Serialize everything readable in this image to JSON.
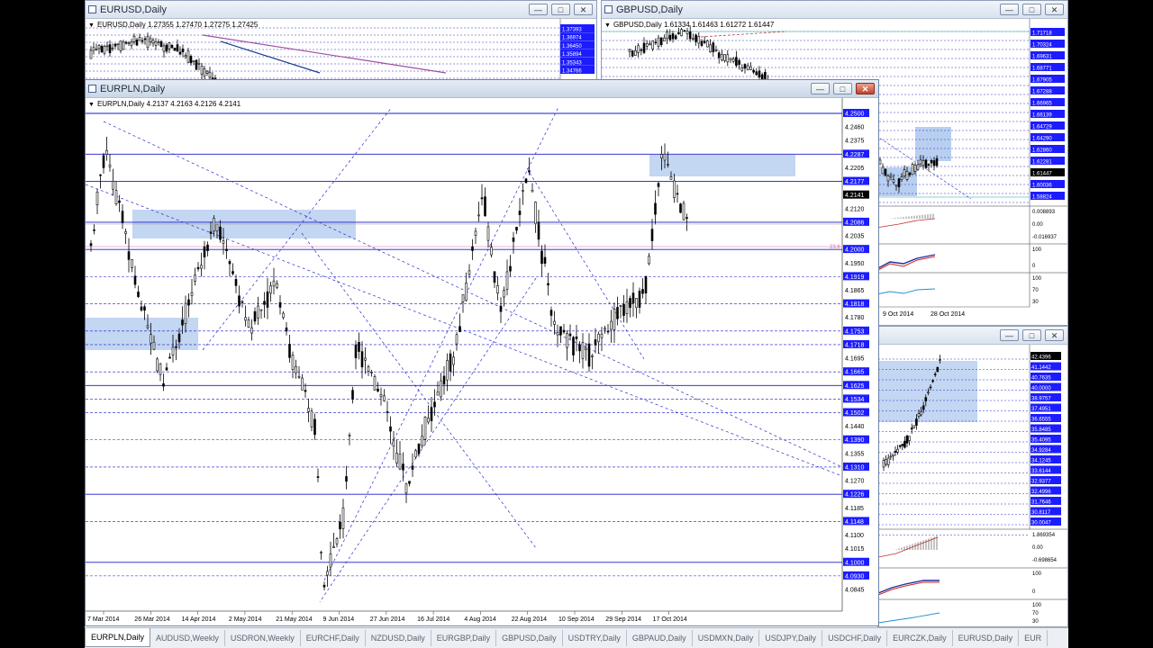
{
  "windows": {
    "eurusd": {
      "title": "EURUSD,Daily",
      "ohlc": "EURUSD,Daily  1.27355 1.27470 1.27275 1.27425",
      "price_labels": [
        "1.37393",
        "1.36974",
        "1.36450",
        "1.35894",
        "1.35343",
        "1.34766"
      ]
    },
    "gbpusd": {
      "title": "GBPUSD,Daily",
      "ohlc": "GBPUSD,Daily  1.61334 1.61463 1.61272 1.61447",
      "price_labels": [
        "1.71718",
        "1.70324",
        "1.69631",
        "1.68771",
        "1.67905",
        "1.67288",
        "1.66965",
        "1.66139",
        "1.64729",
        "1.64290",
        "1.62860",
        "1.62281",
        "1.61447",
        "1.60036",
        "1.58824"
      ],
      "ind1_labels": [
        "0.008893",
        "0.00",
        "-0.016937"
      ],
      "ind2_labels": [
        "100",
        "0"
      ],
      "ind3_labels": [
        "100",
        "70",
        "30"
      ],
      "dates": [
        "9 Oct 2014",
        "28 Oct 2014"
      ]
    },
    "third": {
      "price_labels": [
        "42.4396",
        "41.1442",
        "40.7635",
        "40.0000",
        "38.9757",
        "37.4951",
        "36.6555",
        "35.8485",
        "35.4095",
        "34.9284",
        "34.1245",
        "33.6144",
        "32.9377",
        "32.4996",
        "31.7646",
        "30.8117",
        "30.0047"
      ],
      "ind1_labels": [
        "1.869354",
        "0.00",
        "-0.698654"
      ],
      "ind2_labels": [
        "100",
        "0"
      ],
      "ind3_labels": [
        "100",
        "70",
        "30"
      ]
    },
    "main": {
      "title": "EURPLN,Daily",
      "ohlc": "EURPLN,Daily  4.2137 4.2163 4.2126 4.2141",
      "price_labels": [
        {
          "v": "4.2500",
          "h": true
        },
        {
          "v": "4.2460",
          "h": false
        },
        {
          "v": "4.2375",
          "h": false
        },
        {
          "v": "4.2287",
          "h": true
        },
        {
          "v": "4.2205",
          "h": false
        },
        {
          "v": "4.2177",
          "h": true
        },
        {
          "v": "4.2141",
          "h": true
        },
        {
          "v": "4.2120",
          "h": false
        },
        {
          "v": "4.2086",
          "h": true
        },
        {
          "v": "4.2035",
          "h": false
        },
        {
          "v": "4.2000",
          "h": true
        },
        {
          "v": "4.1950",
          "h": false
        },
        {
          "v": "4.1919",
          "h": true
        },
        {
          "v": "4.1865",
          "h": false
        },
        {
          "v": "4.1818",
          "h": true
        },
        {
          "v": "4.1780",
          "h": false
        },
        {
          "v": "4.1753",
          "h": true
        },
        {
          "v": "4.1718",
          "h": true
        },
        {
          "v": "4.1695",
          "h": false
        },
        {
          "v": "4.1665",
          "h": true
        },
        {
          "v": "4.1625",
          "h": true
        },
        {
          "v": "4.1534",
          "h": true
        },
        {
          "v": "4.1502",
          "h": true
        },
        {
          "v": "4.1440",
          "h": false
        },
        {
          "v": "4.1390",
          "h": true
        },
        {
          "v": "4.1355",
          "h": false
        },
        {
          "v": "4.1310",
          "h": true
        },
        {
          "v": "4.1270",
          "h": false
        },
        {
          "v": "4.1226",
          "h": true
        },
        {
          "v": "4.1185",
          "h": false
        },
        {
          "v": "4.1148",
          "h": true
        },
        {
          "v": "4.1100",
          "h": false
        },
        {
          "v": "4.1015",
          "h": false
        },
        {
          "v": "4.1000",
          "h": true
        },
        {
          "v": "4.0930",
          "h": true
        },
        {
          "v": "4.0845",
          "h": false
        }
      ],
      "date_labels": [
        "7 Mar 2014",
        "26 Mar 2014",
        "14 Apr 2014",
        "2 May 2014",
        "21 May 2014",
        "9 Jun 2014",
        "27 Jun 2014",
        "16 Jul 2014",
        "4 Aug 2014",
        "22 Aug 2014",
        "10 Sep 2014",
        "29 Sep 2014",
        "17 Oct 2014"
      ],
      "fib_label": "23.6"
    }
  },
  "tabs": [
    "EURPLN,Daily",
    "AUDUSD,Weekly",
    "USDRON,Weekly",
    "EURCHF,Daily",
    "NZDUSD,Daily",
    "EURGBP,Daily",
    "GBPUSD,Daily",
    "USDTRY,Daily",
    "GBPAUD,Daily",
    "USDMXN,Daily",
    "USDJPY,Daily",
    "USDCHF,Daily",
    "EURCZK,Daily",
    "EURUSD,Daily",
    "EUR"
  ],
  "colors": {
    "price_highlight": "#1c1cff",
    "level_line": "#0000cc",
    "zone": "#b8cff0",
    "current_price": "#000000"
  }
}
